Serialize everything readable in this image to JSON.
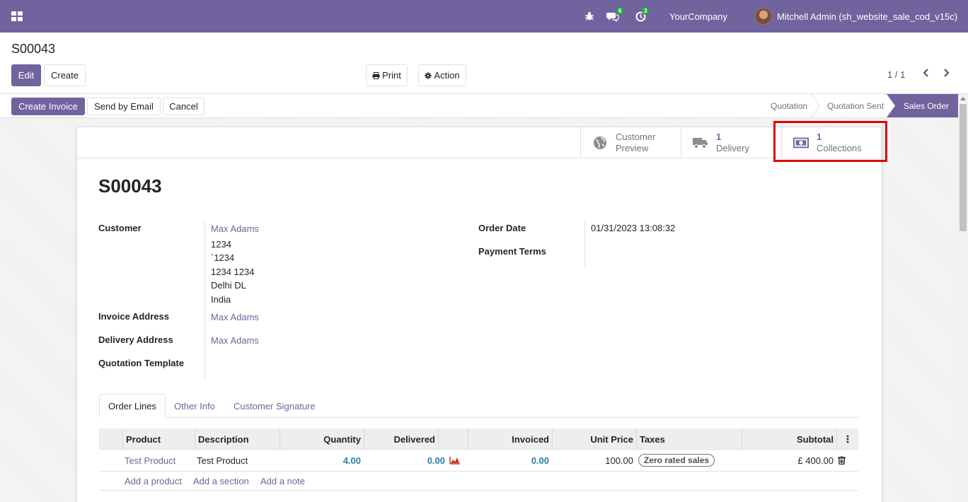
{
  "navbar": {
    "company": "YourCompany",
    "user": "Mitchell Admin (sh_website_sale_cod_v15c)",
    "messages_count": "6",
    "activities_count": "3",
    "icons": [
      "apps-icon",
      "bug-icon",
      "chat-icon",
      "clock-icon"
    ]
  },
  "control_panel": {
    "breadcrumb": "S00043",
    "edit_label": "Edit",
    "create_label": "Create",
    "print_label": "Print",
    "action_label": "Action",
    "pager": "1 / 1"
  },
  "statusbar": {
    "create_invoice_label": "Create Invoice",
    "send_email_label": "Send by Email",
    "cancel_label": "Cancel",
    "stages": [
      "Quotation",
      "Quotation Sent",
      "Sales Order"
    ],
    "active_stage": "Sales Order"
  },
  "smart_buttons": {
    "preview_line1": "Customer",
    "preview_line2": "Preview",
    "delivery_count": "1",
    "delivery_label": "Delivery",
    "collections_count": "1",
    "collections_label": "Collections"
  },
  "form": {
    "title": "S00043",
    "customer_label": "Customer",
    "customer_name": "Max Adams",
    "address_lines": [
      "1234",
      "`1234",
      "1234 1234",
      "Delhi DL",
      "India"
    ],
    "invoice_address_label": "Invoice Address",
    "invoice_address": "Max Adams",
    "delivery_address_label": "Delivery Address",
    "delivery_address": "Max Adams",
    "quotation_template_label": "Quotation Template",
    "order_date_label": "Order Date",
    "order_date": "01/31/2023 13:08:32",
    "payment_terms_label": "Payment Terms"
  },
  "tabs": [
    "Order Lines",
    "Other Info",
    "Customer Signature"
  ],
  "order_lines": {
    "columns": [
      "Product",
      "Description",
      "Quantity",
      "Delivered",
      "Invoiced",
      "Unit Price",
      "Taxes",
      "Subtotal"
    ],
    "rows": [
      {
        "product": "Test Product",
        "description": "Test Product",
        "quantity": "4.00",
        "delivered": "0.00",
        "invoiced": "0.00",
        "unit_price": "100.00",
        "taxes": "Zero rated sales",
        "subtotal": "£ 400.00"
      }
    ],
    "add_product": "Add a product",
    "add_section": "Add a section",
    "add_note": "Add a note"
  },
  "colors": {
    "brand": "#71639e",
    "highlight": "#e00000",
    "badge": "#28a745"
  }
}
